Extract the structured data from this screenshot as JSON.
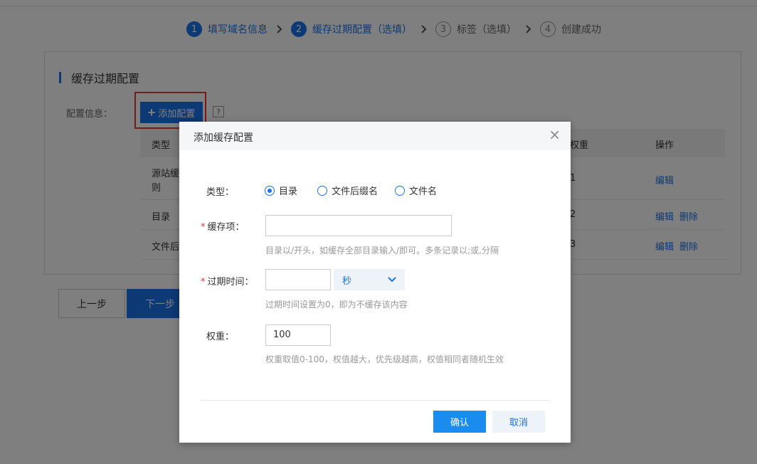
{
  "steps": [
    {
      "num": "1",
      "label": "填写域名信息",
      "state": "active"
    },
    {
      "num": "2",
      "label": "缓存过期配置（选填）",
      "state": "active"
    },
    {
      "num": "3",
      "label": "标签（选填）",
      "state": "pending"
    },
    {
      "num": "4",
      "label": "创建成功",
      "state": "pending"
    }
  ],
  "panel": {
    "title": "缓存过期配置",
    "config_label": "配置信息：",
    "add_button": "添加配置",
    "help": "?",
    "table": {
      "headers": [
        "类型",
        "权重",
        "操作"
      ],
      "rows": [
        {
          "type_line1": "源站缓存",
          "type_line2": "则",
          "weight": "1",
          "actions": [
            "编辑"
          ]
        },
        {
          "type_line1": "目录",
          "type_line2": "",
          "weight": "2",
          "actions": [
            "编辑",
            "删除"
          ]
        },
        {
          "type_line1": "文件后缀",
          "type_line2": "",
          "weight": "3",
          "actions": [
            "编辑",
            "删除"
          ]
        }
      ]
    }
  },
  "nav": {
    "prev": "上一步",
    "next": "下一步"
  },
  "dialog": {
    "title": "添加缓存配置",
    "close": "×",
    "type_label": "类型：",
    "type_options": [
      {
        "label": "目录",
        "checked": true
      },
      {
        "label": "文件后缀名",
        "checked": false
      },
      {
        "label": "文件名",
        "checked": false
      }
    ],
    "cache_item_label": "缓存项：",
    "cache_item_value": "",
    "cache_item_hint": "目录以/开头，如缓存全部目录输入/即可。多条记录以;或,分隔",
    "expire_label": "过期时间：",
    "expire_value": "",
    "expire_unit": "秒",
    "expire_hint": "过期时间设置为0，即为不缓存该内容",
    "weight_label": "权重：",
    "weight_value": "100",
    "weight_hint": "权重取值0-100，权值越大，优先级越高，权值相同者随机生效",
    "required_mark": "*",
    "confirm": "确认",
    "cancel": "取消"
  },
  "colors": {
    "primary": "#1a73e8",
    "required": "#e4393c",
    "highlight": "#e4393c"
  }
}
